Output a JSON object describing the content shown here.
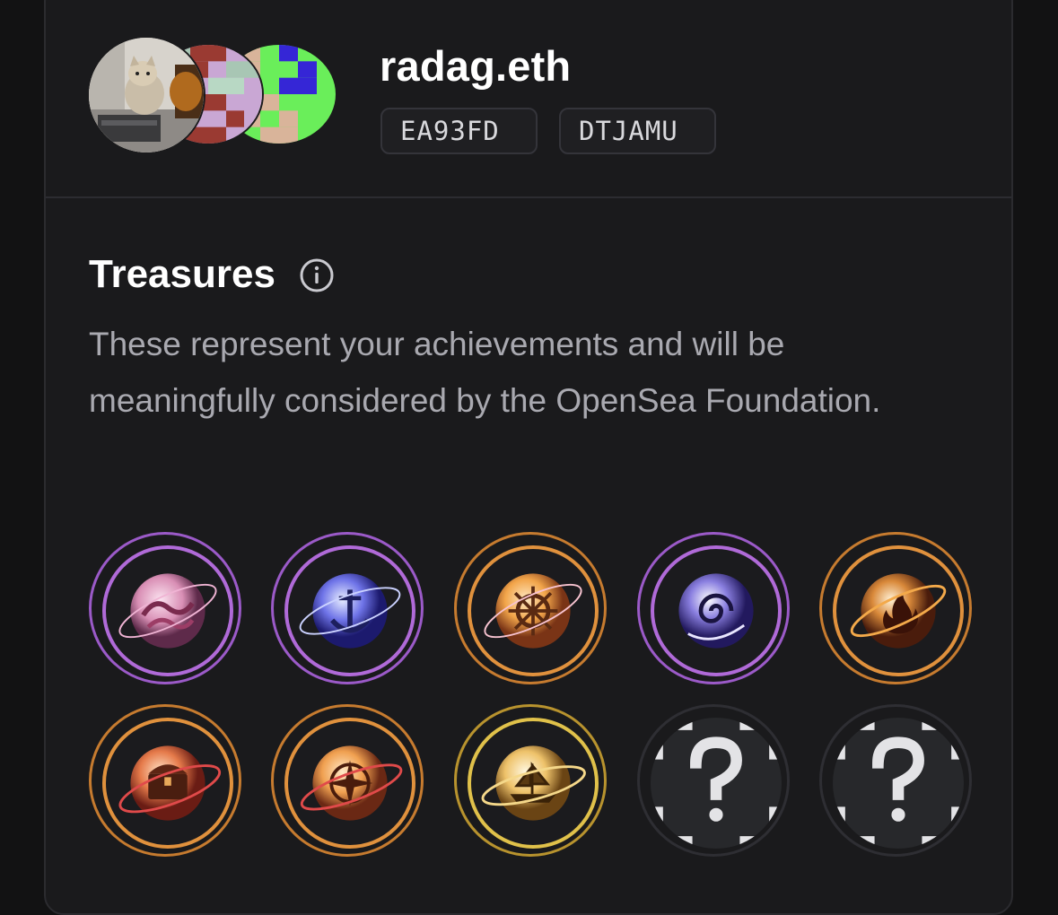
{
  "profile": {
    "username": "radag.eth",
    "tags": [
      "EA93FD",
      "DTJAMU"
    ],
    "avatars": [
      "cat-photo-avatar",
      "pixel-avatar-pink",
      "pixel-avatar-green"
    ]
  },
  "treasures": {
    "title": "Treasures",
    "info_icon": "info-icon",
    "description": "These represent your achievements and will be meaningfully considered by the OpenSea Foundation.",
    "badges": [
      {
        "icon": "wave-orb-icon",
        "tier": "purple",
        "locked": false
      },
      {
        "icon": "anchor-orb-icon",
        "tier": "purple",
        "locked": false
      },
      {
        "icon": "ship-wheel-orb-icon",
        "tier": "orange",
        "locked": false
      },
      {
        "icon": "whirlpool-orb-icon",
        "tier": "purple",
        "locked": false
      },
      {
        "icon": "flame-orb-icon",
        "tier": "orange",
        "locked": false
      },
      {
        "icon": "treasure-chest-orb-icon",
        "tier": "orange",
        "locked": false
      },
      {
        "icon": "compass-orb-icon",
        "tier": "orange",
        "locked": false
      },
      {
        "icon": "ship-orb-icon",
        "tier": "gold",
        "locked": false
      },
      {
        "icon": "unknown-badge-icon",
        "tier": "locked",
        "locked": true
      },
      {
        "icon": "unknown-badge-icon",
        "tier": "locked",
        "locked": true
      }
    ]
  },
  "colors": {
    "background": "#121213",
    "card": "#1a1a1c",
    "purple_ring": "#b06ad8",
    "orange_ring": "#e0913d",
    "gold_ring": "#e0c14a",
    "muted_text": "#a9a9b0"
  }
}
